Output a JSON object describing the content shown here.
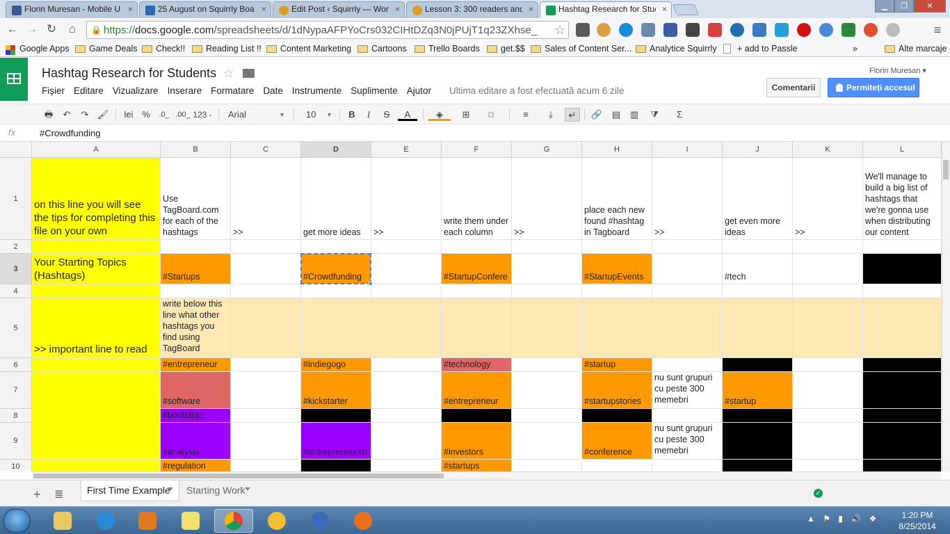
{
  "browser": {
    "tabs": [
      {
        "label": "Florin Muresan - Mobile U",
        "color": "#3b5998"
      },
      {
        "label": "25 August on Squirrly Boa",
        "color": "#2a6bb0"
      },
      {
        "label": "Edit Post ‹ Squirrly — Wor",
        "color": "#d9a020"
      },
      {
        "label": "Lesson 3: 300 readers and",
        "color": "#d9a020"
      },
      {
        "label": "Hashtag Research for Stuc",
        "color": "#0f9d58"
      }
    ],
    "url_https": "https://",
    "url_host": "docs.google.com",
    "url_path": "/spreadsheets/d/1dNypaAFPYoCrs032CIHtDZq3N0jPUjT1q23ZXhse_",
    "extensions": [
      "bookmarklet-icon",
      "toast-icon",
      "edge-icon",
      "zoom-search-icon",
      "user-icon",
      "pocket-icon",
      "arrow-icon",
      "globe-icon",
      "bell-icon",
      "m-icon",
      "opera-icon",
      "chrome-icon",
      "chart-icon",
      "octopus-icon",
      "ip-icon",
      "menu-icon"
    ],
    "bookmarks": [
      "Google Apps",
      "Game Deals",
      "Check!!",
      "Reading List !!",
      "Content Marketing",
      "Cartoons",
      "Trello Boards",
      "get.$$",
      "Sales of Content Ser...",
      "Analytice Squirrly",
      "+ add to Passle",
      "»",
      "Alte marcaje"
    ]
  },
  "sheets": {
    "title": "Hashtag Research for Students",
    "user": "Florin Muresan",
    "menu": [
      "Fișier",
      "Editare",
      "Vizualizare",
      "Inserare",
      "Formatare",
      "Date",
      "Instrumente",
      "Suplimente",
      "Ajutor"
    ],
    "last_edit": "Ultima editare a fost efectuată acum 6 zile",
    "comments_label": "Comentarii",
    "share_label": "Permiteți accesul",
    "toolbar": {
      "currency": "lei",
      "percent": "%",
      "dec_less": ".0_",
      "dec_more": ".00_",
      "format": "123 -",
      "font": "Arial",
      "size": "10"
    },
    "formula_value": "#Crowdfunding"
  },
  "grid": {
    "columns": [
      "A",
      "B",
      "C",
      "D",
      "E",
      "F",
      "G",
      "H",
      "I",
      "J",
      "K",
      "L"
    ],
    "selected_column": "D",
    "selected_row": "3",
    "rows": [
      {
        "id": "1",
        "cells": {
          "A": "on this line you will see the tips for completing this file on your own",
          "B": "Use TagBoard.com for each of the hashtags",
          "C": ">>",
          "D": "get more ideas",
          "E": ">>",
          "F": "write them under each column",
          "G": ">>",
          "H": "place each new found #hashtag in Tagboard",
          "I": ">>",
          "J": "get even more ideas",
          "K": ">>",
          "L": "We'll manage to build a big list of hashtags that we're gonna use when distributing our content"
        }
      },
      {
        "id": "2",
        "cells": {}
      },
      {
        "id": "3",
        "cells": {
          "A": "Your Starting Topics (Hashtags)",
          "B": "#Startups",
          "D": "#Crowdfunding",
          "F": "#StartupConfere",
          "H": "#StartupEvents",
          "J": "#tech"
        }
      },
      {
        "id": "4",
        "cells": {}
      },
      {
        "id": "5",
        "cells": {
          "A": ">> important line to read",
          "B": "write below this line what other hashtags you find using TagBoard"
        }
      },
      {
        "id": "6",
        "cells": {
          "B": "#entrepreneur",
          "D": "#indiegogo",
          "F": "#technology",
          "H": "#startup"
        }
      },
      {
        "id": "7",
        "cells": {
          "B": "#software",
          "D": "#kickstarter",
          "F": "#entrepreneur",
          "H": "#startupstories",
          "I": "nu sunt grupuri cu peste 300 memebri",
          "J": "#startup"
        }
      },
      {
        "id": "8",
        "cells": {
          "B": "#bootstrap"
        }
      },
      {
        "id": "9",
        "cells": {
          "B": "#analysis",
          "D": "#entrepreneursh",
          "F": "#investors",
          "H": "#conference",
          "I": "nu sunt grupuri cu peste 300 memebri"
        }
      },
      {
        "id": "10",
        "cells": {
          "B": "#regulation",
          "F": "#startups"
        }
      }
    ],
    "fill_colors": {
      "yellow": "#ffff00",
      "orange": "#ff9900",
      "red": "#e06666",
      "purple": "#9900ff",
      "black": "#000000",
      "cream": "#fce8b2"
    }
  },
  "sheet_tabs": [
    "First Time Example",
    "Starting Work"
  ],
  "taskbar": {
    "time": "1:20 PM",
    "date": "8/25/2014",
    "apps": [
      "explorer-icon",
      "ie-icon",
      "media-player-icon",
      "sticky-notes-icon",
      "chrome-icon",
      "pidgin-icon",
      "thunderbird-icon",
      "firefox-icon"
    ]
  }
}
